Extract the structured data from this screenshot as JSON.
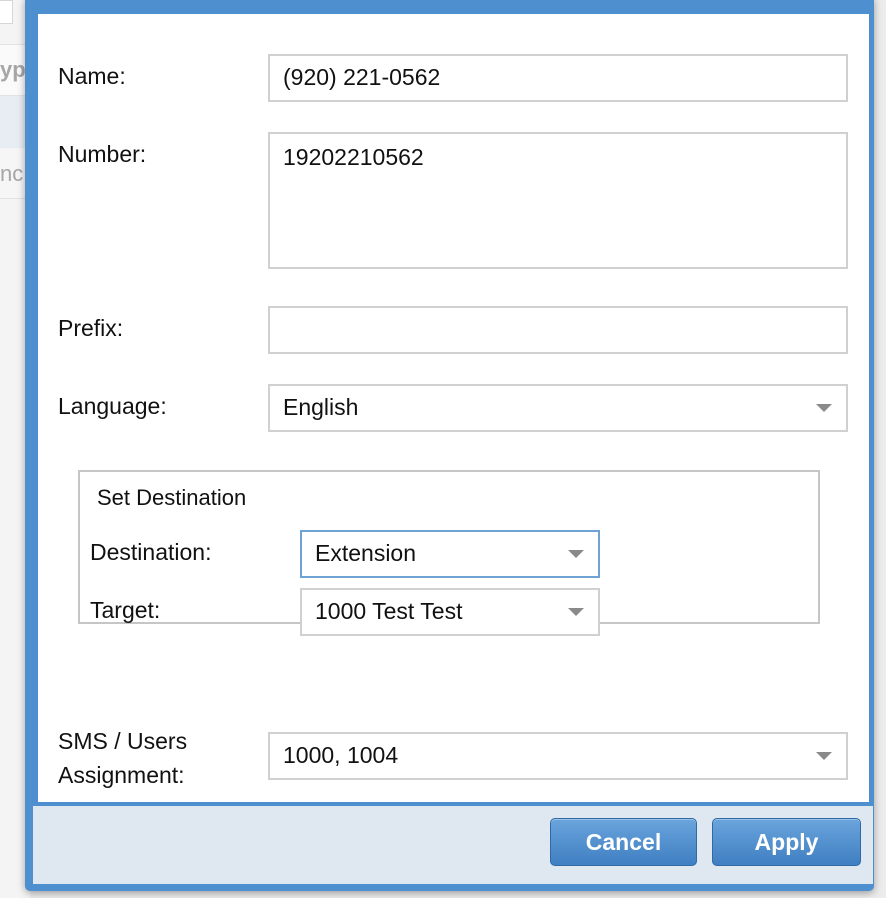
{
  "background": {
    "row1_text": "yp",
    "row3_text": "nc"
  },
  "form": {
    "name": {
      "label": "Name:",
      "value": "(920) 221-0562"
    },
    "number": {
      "label": "Number:",
      "value": "19202210562"
    },
    "prefix": {
      "label": "Prefix:",
      "value": ""
    },
    "language": {
      "label": "Language:",
      "value": "English"
    },
    "set_destination": {
      "legend": "Set Destination",
      "destination": {
        "label": "Destination:",
        "value": "Extension"
      },
      "target": {
        "label": "Target:",
        "value": "1000 Test Test"
      }
    },
    "sms_users": {
      "label_line1": "SMS / Users",
      "label_line2": "Assignment:",
      "value": "1000, 1004"
    }
  },
  "footer": {
    "cancel_label": "Cancel",
    "apply_label": "Apply"
  },
  "colors": {
    "dialog_frame": "#4e90cf",
    "button": "#4f8cca",
    "footer": "#dfe8f1"
  },
  "icons": {
    "dropdown": "chevron-down-icon"
  }
}
